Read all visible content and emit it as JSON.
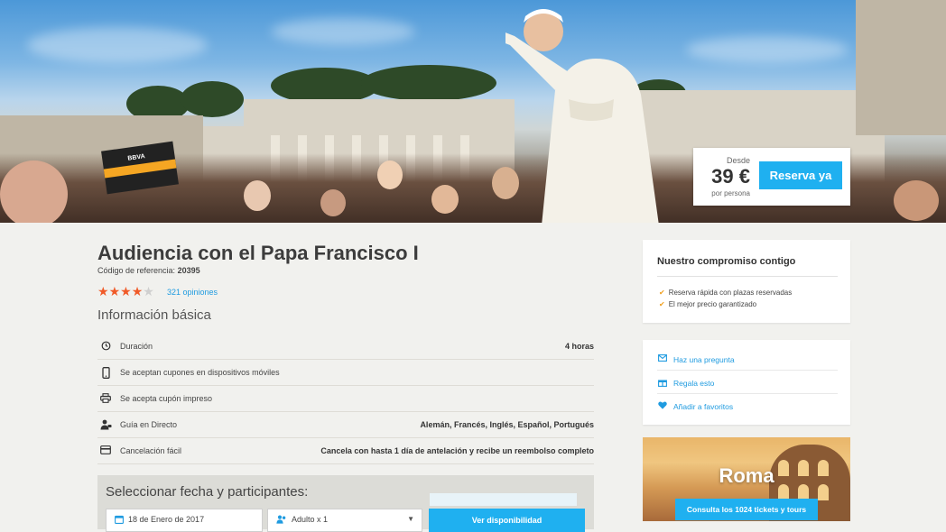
{
  "hero": {
    "price_from": "Desde",
    "price": "39 €",
    "price_unit": "por persona",
    "book_button": "Reserva ya",
    "flag_text": "BBVA"
  },
  "product": {
    "title": "Audiencia con el Papa Francisco I",
    "ref_label": "Código de referencia:",
    "ref_value": "20395",
    "rating": 4,
    "rating_max": 5,
    "opinions": "321 opiniones",
    "section_title": "Información básica"
  },
  "info_rows": [
    {
      "icon": "clock-icon",
      "label": "Duración",
      "value": "4 horas"
    },
    {
      "icon": "mobile-icon",
      "label": "Se aceptan cupones en dispositivos móviles",
      "value": ""
    },
    {
      "icon": "printer-icon",
      "label": "Se acepta cupón impreso",
      "value": ""
    },
    {
      "icon": "guide-icon",
      "label": "Guía en Directo",
      "value": "Alemán, Francés, Inglés, Español, Portugués"
    },
    {
      "icon": "card-icon",
      "label": "Cancelación fácil",
      "value": "Cancela con hasta 1 día de antelación y recibe un reembolso completo"
    }
  ],
  "booking": {
    "title": "Seleccionar fecha y participantes:",
    "date": "18 de Enero de 2017",
    "participants": "Adulto x 1",
    "button": "Ver disponibilidad"
  },
  "commitment": {
    "title": "Nuestro compromiso contigo",
    "items": [
      "Reserva rápida con plazas reservadas",
      "El mejor precio garantizado"
    ]
  },
  "actions": [
    {
      "icon": "mail-icon",
      "label": "Haz una pregunta"
    },
    {
      "icon": "gift-icon",
      "label": "Regala esto"
    },
    {
      "icon": "heart-icon",
      "label": "Añadir a favoritos"
    }
  ],
  "promo": {
    "city": "Roma",
    "button": "Consulta los 1024 tickets y tours"
  }
}
